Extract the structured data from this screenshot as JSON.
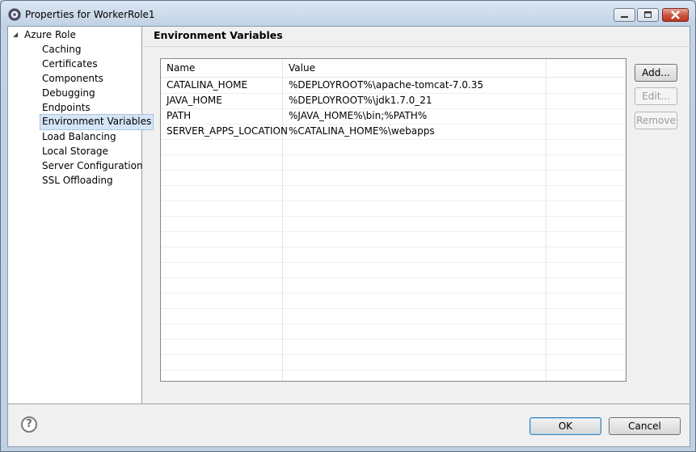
{
  "window": {
    "title": "Properties for WorkerRole1"
  },
  "tree": {
    "root": "Azure Role",
    "items": [
      "Caching",
      "Certificates",
      "Components",
      "Debugging",
      "Endpoints",
      "Environment Variables",
      "Load Balancing",
      "Local Storage",
      "Server Configuration",
      "SSL Offloading"
    ],
    "selected": "Environment Variables"
  },
  "page": {
    "title": "Environment Variables"
  },
  "table": {
    "columns": [
      "Name",
      "Value"
    ],
    "rows": [
      {
        "name": "CATALINA_HOME",
        "value": "%DEPLOYROOT%\\apache-tomcat-7.0.35"
      },
      {
        "name": "JAVA_HOME",
        "value": "%DEPLOYROOT%\\jdk1.7.0_21"
      },
      {
        "name": "PATH",
        "value": "%JAVA_HOME%\\bin;%PATH%"
      },
      {
        "name": "SERVER_APPS_LOCATION",
        "value": "%CATALINA_HOME%\\webapps"
      }
    ]
  },
  "buttons": {
    "add": "Add...",
    "edit": "Edit...",
    "remove": "Remove",
    "ok": "OK",
    "cancel": "Cancel"
  },
  "help": {
    "glyph": "?"
  },
  "icons": {
    "window": "eclipse-gear-icon",
    "minimize": "minimize-icon",
    "maximize": "maximize-icon",
    "close": "close-icon",
    "help": "help-icon"
  }
}
